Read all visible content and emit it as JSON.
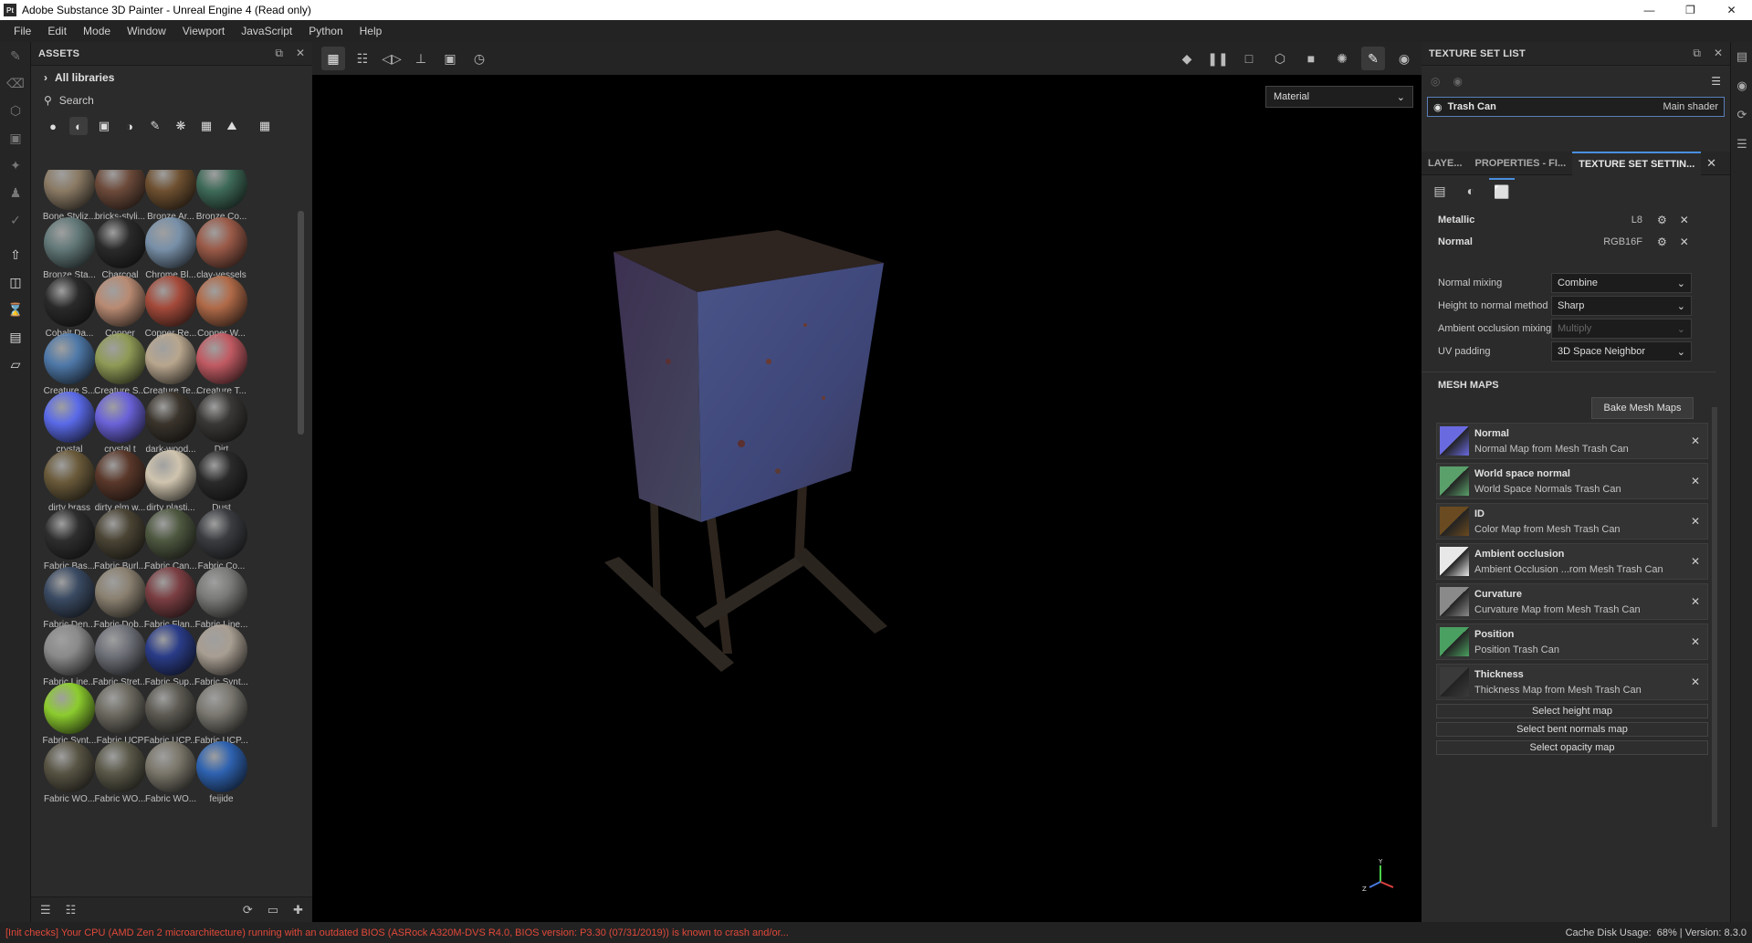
{
  "window": {
    "app_icon": "Pt",
    "title": "Adobe Substance 3D Painter - Unreal Engine 4 (Read only)"
  },
  "menu": [
    "File",
    "Edit",
    "Mode",
    "Window",
    "Viewport",
    "JavaScript",
    "Python",
    "Help"
  ],
  "assets": {
    "title": "ASSETS",
    "library": "All libraries",
    "search_placeholder": "Search",
    "items": [
      {
        "label": "Bone Styliz...",
        "color": "#8a7a64"
      },
      {
        "label": "bricks-styli...",
        "color": "#6c4a3a"
      },
      {
        "label": "Bronze Ar...",
        "color": "#6e5030"
      },
      {
        "label": "Bronze Co...",
        "color": "#3e6a58"
      },
      {
        "label": "Bronze Sta...",
        "color": "#627878"
      },
      {
        "label": "Charcoal",
        "color": "#2a2a2a"
      },
      {
        "label": "Chrome Bl...",
        "color": "#7890a8"
      },
      {
        "label": "clay-vessels",
        "color": "#9a5a48"
      },
      {
        "label": "Cobalt Da...",
        "color": "#2a2a2a"
      },
      {
        "label": "Copper",
        "color": "#b88a72"
      },
      {
        "label": "Copper Re...",
        "color": "#a44a3a"
      },
      {
        "label": "Copper W...",
        "color": "#b06a48"
      },
      {
        "label": "Creature S...",
        "color": "#4e78a8"
      },
      {
        "label": "Creature S...",
        "color": "#8e9a56"
      },
      {
        "label": "Creature Te...",
        "color": "#b8a68e"
      },
      {
        "label": "Creature T...",
        "color": "#c05a62"
      },
      {
        "label": "crystal",
        "color": "#5a6ae8"
      },
      {
        "label": "crystal t",
        "color": "#6a62d8"
      },
      {
        "label": "dark-wood...",
        "color": "#3a342c"
      },
      {
        "label": "Dirt",
        "color": "#3a3836"
      },
      {
        "label": "dirty brass",
        "color": "#6a5a3a"
      },
      {
        "label": "dirty elm w...",
        "color": "#5a382a"
      },
      {
        "label": "dirty plasti...",
        "color": "#cfc4ae"
      },
      {
        "label": "Dust",
        "color": "#2a2a2a"
      },
      {
        "label": "Fabric Bas...",
        "color": "#2e2e2e"
      },
      {
        "label": "Fabric Burl...",
        "color": "#4a4434"
      },
      {
        "label": "Fabric Can...",
        "color": "#4e5840"
      },
      {
        "label": "Fabric Co...",
        "color": "#3a3c40"
      },
      {
        "label": "Fabric Den...",
        "color": "#3a4a62"
      },
      {
        "label": "Fabric Dob...",
        "color": "#8a8070"
      },
      {
        "label": "Fabric Flan...",
        "color": "#7a3e42"
      },
      {
        "label": "Fabric Line...",
        "color": "#7a7a78"
      },
      {
        "label": "Fabric Line...",
        "color": "#8a8a8a"
      },
      {
        "label": "Fabric Stret...",
        "color": "#6e7078"
      },
      {
        "label": "Fabric Sup...",
        "color": "#2a3c88"
      },
      {
        "label": "Fabric Synt...",
        "color": "#a89e92"
      },
      {
        "label": "Fabric Synt...",
        "color": "#8ccc2e"
      },
      {
        "label": "Fabric UCP",
        "color": "#6c6a60"
      },
      {
        "label": "Fabric UCP...",
        "color": "#5c5a52"
      },
      {
        "label": "Fabric UCP...",
        "color": "#7a7870"
      },
      {
        "label": "Fabric WO...",
        "color": "#585444"
      },
      {
        "label": "Fabric WO...",
        "color": "#5a5848"
      },
      {
        "label": "Fabric WO...",
        "color": "#7a766a"
      },
      {
        "label": "feijide",
        "color": "#2e62b0"
      }
    ]
  },
  "viewport": {
    "mode": "Material"
  },
  "texture_set_list": {
    "title": "TEXTURE SET LIST",
    "item_name": "Trash Can",
    "item_shader": "Main shader"
  },
  "tabs": {
    "layers": "LAYE...",
    "properties": "PROPERTIES - FI...",
    "settings": "TEXTURE SET SETTIN..."
  },
  "channels": [
    {
      "name": "Metallic",
      "format": "L8"
    },
    {
      "name": "Normal",
      "format": "RGB16F"
    }
  ],
  "props": {
    "normal_mixing_label": "Normal mixing",
    "normal_mixing_value": "Combine",
    "height_label": "Height to normal method",
    "height_value": "Sharp",
    "ao_label": "Ambient occlusion mixing",
    "ao_value": "Multiply",
    "uv_label": "UV padding",
    "uv_value": "3D Space Neighbor"
  },
  "mesh_maps": {
    "title": "MESH MAPS",
    "bake_label": "Bake Mesh Maps",
    "items": [
      {
        "name": "Normal",
        "source": "Normal Map from Mesh Trash Can",
        "color": "#6a6ae0"
      },
      {
        "name": "World space normal",
        "source": "World Space Normals Trash Can",
        "color": "#5aa06a"
      },
      {
        "name": "ID",
        "source": "Color Map from Mesh Trash Can",
        "color": "#6a4a20"
      },
      {
        "name": "Ambient occlusion",
        "source": "Ambient Occlusion ...rom Mesh Trash Can",
        "color": "#e8e8e8"
      },
      {
        "name": "Curvature",
        "source": "Curvature Map from Mesh Trash Can",
        "color": "#8a8a8a"
      },
      {
        "name": "Position",
        "source": "Position Trash Can",
        "color": "#4aa060"
      },
      {
        "name": "Thickness",
        "source": "Thickness Map from Mesh Trash Can",
        "color": "#3a3a3a"
      }
    ],
    "select_height": "Select height map",
    "select_bent": "Select bent normals map",
    "select_opacity": "Select opacity map"
  },
  "status": {
    "message": "[Init checks] Your CPU (AMD Zen 2 microarchitecture) running with an outdated BIOS (ASRock A320M-DVS R4.0, BIOS version: P3.30 (07/31/2019)) is known to crash and/or...",
    "cache": "Cache Disk Usage:",
    "cache_value": "68% | Version: 8.3.0"
  }
}
